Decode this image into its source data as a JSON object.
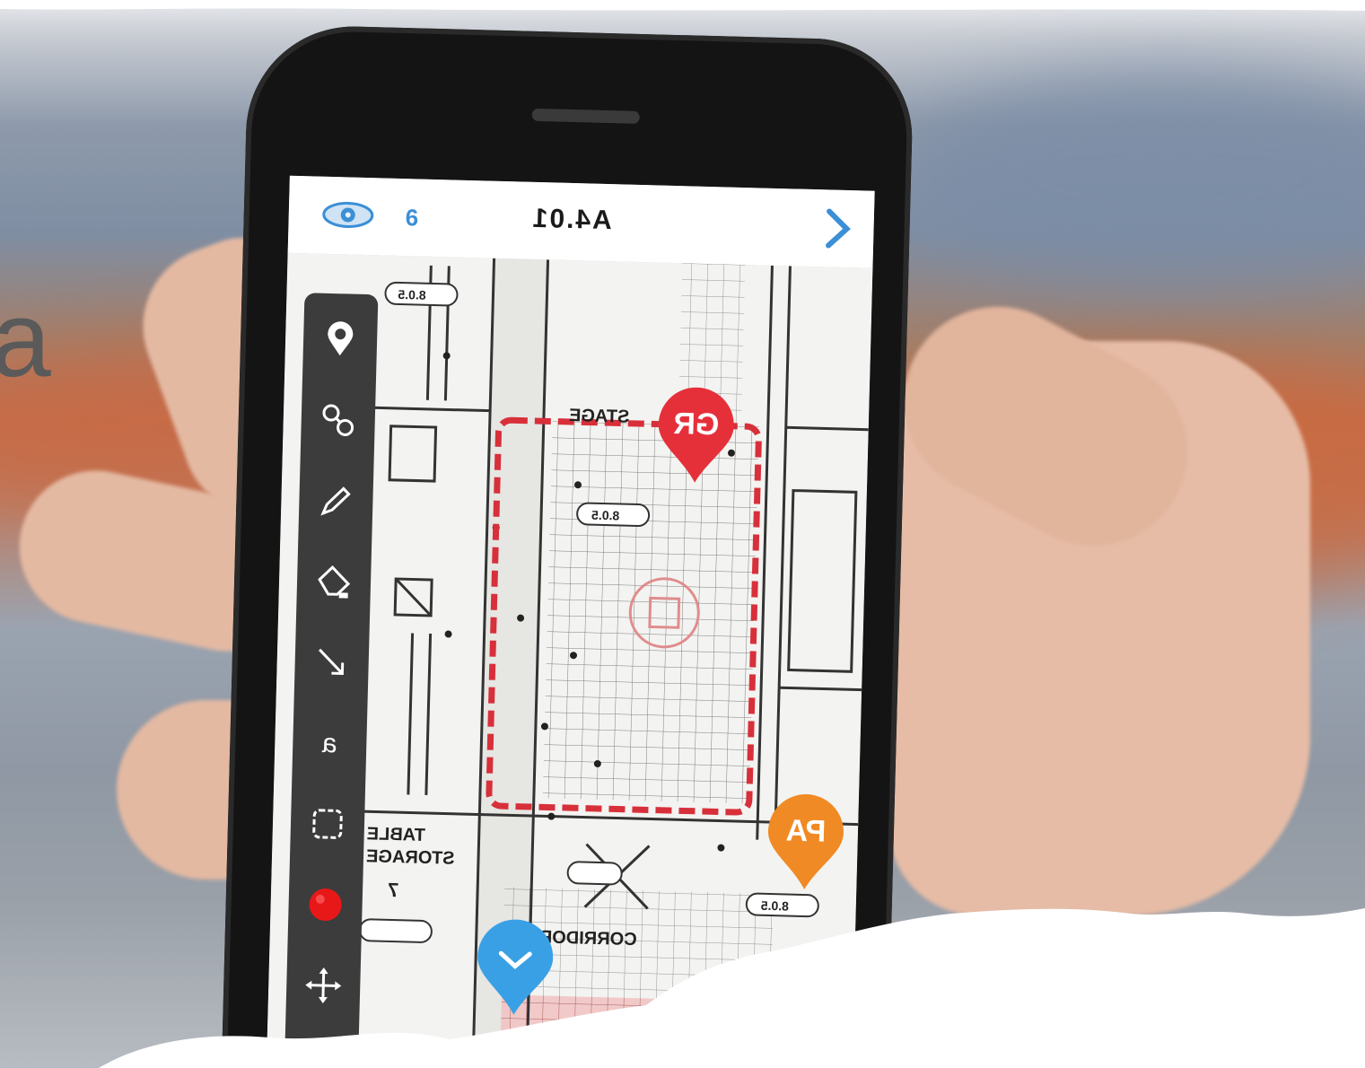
{
  "side_text": {
    "letter": "a"
  },
  "app": {
    "eye_count": "6",
    "sheet_title": "A4.01"
  },
  "toolbar": {
    "tools": [
      "pin",
      "link",
      "pencil",
      "highlighter",
      "arrow",
      "text",
      "cloud",
      "record",
      "move"
    ]
  },
  "pins": [
    {
      "label": "GR",
      "color": "#e5303a"
    },
    {
      "label": "PA",
      "color": "#f08a24"
    },
    {
      "label": "",
      "color": "#3aa0e6"
    }
  ],
  "plan_labels": {
    "stage": "STAGE",
    "storage_1": "TABLE",
    "storage_2": "STORAGE",
    "corridor": "CORRIDOR",
    "tag_1": "8.0.5",
    "tag_2": "8.0.5",
    "tag_3": "8.0.5",
    "room_number": "7"
  },
  "colors": {
    "markup_red": "#d7303a",
    "pin_red": "#e5303a",
    "pin_orange": "#f08a24",
    "pin_blue": "#3aa0e6",
    "record_red": "#e81818",
    "accent_blue": "#3b8fd6"
  }
}
